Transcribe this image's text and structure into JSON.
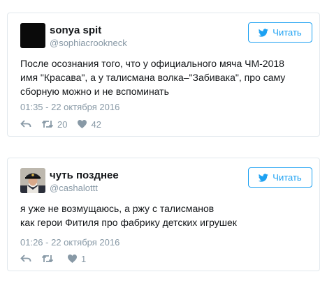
{
  "tweets": [
    {
      "name": "sonya spit",
      "handle": "@sophiacrookneck",
      "follow_label": "Читать",
      "text_lines": [
        "После осознания того, что у официального мяча ЧМ-2018",
        "имя \"Красава\", а у талисмана волка–\"Забивака\", про саму",
        "сборную можно и не вспоминать"
      ],
      "timestamp": "01:35 - 22 октября 2016",
      "retweets": "20",
      "likes": "42",
      "avatar": "black-square"
    },
    {
      "name": "чуть позднее",
      "handle": "@cashalottt",
      "follow_label": "Читать",
      "text_lines": [
        "я уже не возмущаюсь, а ржу с талисманов",
        "как герои Фитиля про фабрику детских игрушек"
      ],
      "timestamp": "01:26 - 22 октября 2016",
      "retweets": "",
      "likes": "1",
      "avatar": "captain-portrait"
    }
  ],
  "icons": {
    "follow": "twitter-bird-icon",
    "reply": "reply-icon",
    "retweet": "retweet-icon",
    "like": "heart-icon"
  },
  "colors": {
    "accent": "#1da1f2",
    "muted": "#8899a6",
    "border": "#e1e8ed",
    "text": "#14171a"
  }
}
